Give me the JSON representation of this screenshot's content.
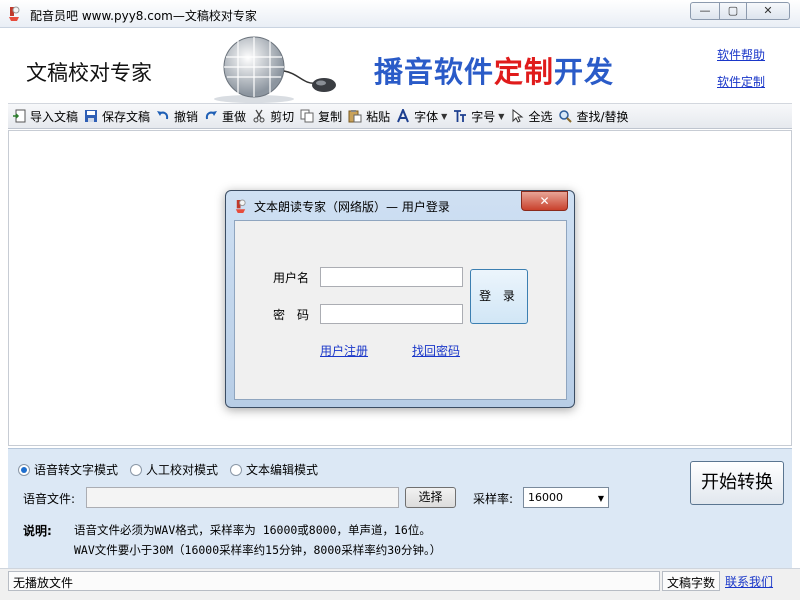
{
  "window": {
    "title": "配音员吧 www.pyy8.com—文稿校对专家",
    "minimize": "—",
    "maximize": "▢",
    "close": "✕"
  },
  "banner": {
    "title": "文稿校对专家",
    "slogan_part1": "播音软件",
    "slogan_part2": "定制",
    "slogan_part3": "开发",
    "help_link": "软件帮助",
    "custom_link": "软件定制"
  },
  "toolbar": {
    "items": [
      {
        "label": "导入文稿",
        "icon": "import-icon"
      },
      {
        "label": "保存文稿",
        "icon": "save-icon"
      },
      {
        "label": "撤销",
        "icon": "undo-icon"
      },
      {
        "label": "重做",
        "icon": "redo-icon"
      },
      {
        "label": "剪切",
        "icon": "cut-icon"
      },
      {
        "label": "复制",
        "icon": "copy-icon"
      },
      {
        "label": "粘贴",
        "icon": "paste-icon"
      },
      {
        "label": "字体",
        "icon": "font-icon"
      },
      {
        "label": "字号",
        "icon": "font-size-icon"
      },
      {
        "label": "全选",
        "icon": "cursor-icon"
      },
      {
        "label": "查找/替换",
        "icon": "find-icon"
      }
    ]
  },
  "dialog": {
    "title": "文本朗读专家（网络版）— 用户登录",
    "close": "✕",
    "username_label": "用户名",
    "password_label": "密　码",
    "username_value": "",
    "password_value": "",
    "login_button": "登 录",
    "register_link": "用户注册",
    "forgot_link": "找回密码"
  },
  "panel": {
    "modes": [
      {
        "label": "语音转文字模式",
        "checked": true
      },
      {
        "label": "人工校对模式",
        "checked": false
      },
      {
        "label": "文本编辑模式",
        "checked": false
      }
    ],
    "file_label": "语音文件:",
    "file_value": "",
    "choose_button": "选择",
    "rate_label": "采样率:",
    "rate_value": "16000",
    "start_button": "开始转换",
    "note_head": "说明:",
    "note_line1": "语音文件必须为WAV格式，采样率为 16000或8000，单声道，16位。",
    "note_line2": "WAV文件要小于30M（16000采样率约15分钟，8000采样率约30分钟。）"
  },
  "status": {
    "left": "无播放文件",
    "count": "文稿字数",
    "contact": "联系我们"
  },
  "colors": {
    "slogan_blue": "#2a5bc8",
    "slogan_red": "#e01b1b",
    "link_blue": "#1a37c9",
    "panel_bg": "#dce8f5"
  }
}
